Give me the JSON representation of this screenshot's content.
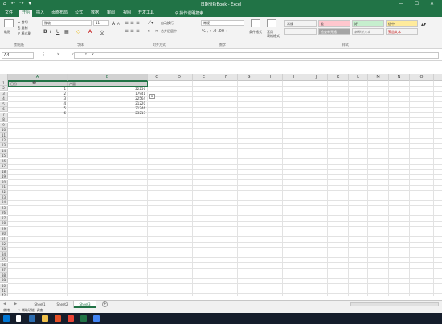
{
  "titlebar": {
    "title": "日期分析Book - Excel",
    "quick_access": "⌂ ↶ ↷ ▾",
    "window_controls": "— ☐ ✕"
  },
  "tabs": [
    {
      "label": "文件"
    },
    {
      "label": "开始"
    },
    {
      "label": "插入"
    },
    {
      "label": "页面布局"
    },
    {
      "label": "公式"
    },
    {
      "label": "数据"
    },
    {
      "label": "审阅"
    },
    {
      "label": "视图"
    },
    {
      "label": "开发工具"
    }
  ],
  "tell_me": "♀ 操作说明搜索",
  "ribbon": {
    "groups": {
      "clipboard": "剪贴板",
      "font": "字体",
      "alignment": "对齐方式",
      "number": "数字",
      "styles": "样式"
    },
    "clipboard": {
      "paste": "粘贴",
      "cut": "✂ 剪切",
      "copy": "⎘ 复制",
      "format_painter": "✐ 格式刷"
    },
    "font": {
      "family": "微软",
      "size": "11",
      "bold": "B",
      "italic": "I",
      "underline": "U",
      "grow": "A",
      "shrink": "A",
      "fill": "◇",
      "color": "A",
      "phonetic": "文"
    },
    "alignment": {
      "wrap": "自动换行",
      "merge": "合并后居中"
    },
    "number": {
      "format": "常规",
      "symbols": "% , ←.0 .00→"
    },
    "styles": {
      "conditional": "条件格式",
      "as_table": "套用\n表格格式",
      "cells": [
        {
          "label": "常规",
          "bg": "#ffffff"
        },
        {
          "label": "差",
          "bg": "#ffc7ce"
        },
        {
          "label": "好",
          "bg": "#c6efce"
        },
        {
          "label": "适中",
          "bg": "#ffeb9c"
        },
        {
          "label": "检查单元格",
          "bg": "#a5a5a5"
        },
        {
          "label": "解释性文本",
          "bg": "#ffffff"
        },
        {
          "label": "警告文本",
          "bg": "#ffffff"
        }
      ]
    }
  },
  "formula_bar": {
    "name_box": "A4",
    "fx_icons": "⋮ ✕ ✓ fx",
    "value": ""
  },
  "columns": [
    "A",
    "B",
    "C",
    "D",
    "E",
    "F",
    "G",
    "H",
    "I",
    "J",
    "K",
    "L",
    "M",
    "N",
    "O"
  ],
  "rows": [
    "1",
    "2",
    "3",
    "4",
    "5",
    "6",
    "7",
    "8",
    "9",
    "10",
    "11",
    "12",
    "13",
    "14",
    "15",
    "16",
    "17",
    "18",
    "19",
    "20",
    "21",
    "22",
    "23",
    "24",
    "25",
    "26",
    "27",
    "28",
    "29",
    "30",
    "31",
    "32",
    "33",
    "34",
    "35",
    "36",
    "37",
    "38",
    "39",
    "40",
    "41",
    "42"
  ],
  "table": {
    "headers": [
      "日份",
      "产量"
    ],
    "data": [
      {
        "a": "1",
        "b": "22256"
      },
      {
        "a": "2",
        "b": "17941"
      },
      {
        "a": "3",
        "b": "22564"
      },
      {
        "a": "4",
        "b": "21220"
      },
      {
        "a": "5",
        "b": "21246"
      },
      {
        "a": "6",
        "b": "23213"
      }
    ]
  },
  "quick_analysis": "⊞",
  "sheets": [
    {
      "label": "Sheet1"
    },
    {
      "label": "Sheet2"
    },
    {
      "label": "Sheet3"
    }
  ],
  "nav_arrows": "◀ ▶",
  "add_sheet": "+",
  "status": {
    "ready": "就绪",
    "accessibility": "⚐ 辅助功能: 调查"
  },
  "taskbar_icon_colors": [
    "#0078d7",
    "#ffffff",
    "#2b6cb0",
    "#f0c14b",
    "#e34f26",
    "#ea4335",
    "#217346",
    "#4285f4"
  ]
}
